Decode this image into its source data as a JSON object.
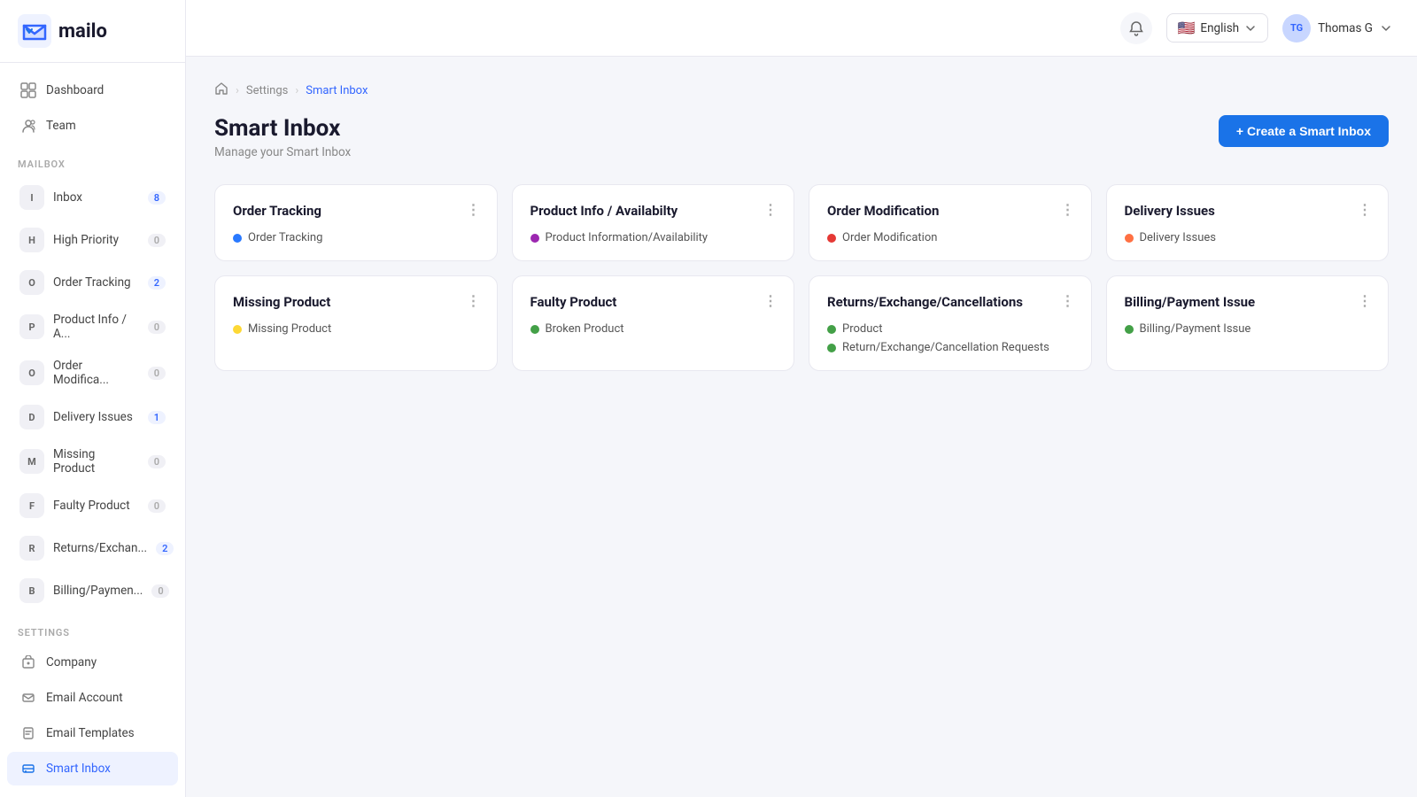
{
  "logo": {
    "text": "mailo"
  },
  "topbar": {
    "language": "English",
    "user_initials": "TG",
    "user_name": "Thomas G"
  },
  "breadcrumb": {
    "home": "home",
    "settings": "Settings",
    "current": "Smart Inbox"
  },
  "page": {
    "title": "Smart Inbox",
    "subtitle": "Manage your Smart Inbox",
    "create_button": "+ Create a Smart Inbox"
  },
  "sidebar": {
    "mailbox_label": "Mailbox",
    "settings_label": "Settings",
    "nav_items": [
      {
        "id": "dashboard",
        "label": "Dashboard",
        "icon": ""
      },
      {
        "id": "team",
        "label": "Team",
        "icon": ""
      }
    ],
    "mailbox_items": [
      {
        "id": "inbox",
        "letter": "I",
        "label": "Inbox",
        "count": "8",
        "nonzero": true
      },
      {
        "id": "high-priority",
        "letter": "H",
        "label": "High Priority",
        "count": "0",
        "nonzero": false
      },
      {
        "id": "order-tracking",
        "letter": "O",
        "label": "Order Tracking",
        "count": "2",
        "nonzero": true
      },
      {
        "id": "product-info",
        "letter": "P",
        "label": "Product Info / A...",
        "count": "0",
        "nonzero": false
      },
      {
        "id": "order-modifica",
        "letter": "O",
        "label": "Order Modifica...",
        "count": "0",
        "nonzero": false
      },
      {
        "id": "delivery-issues",
        "letter": "D",
        "label": "Delivery Issues",
        "count": "1",
        "nonzero": true
      },
      {
        "id": "missing-product",
        "letter": "M",
        "label": "Missing Product",
        "count": "0",
        "nonzero": false
      },
      {
        "id": "faulty-product",
        "letter": "F",
        "label": "Faulty Product",
        "count": "0",
        "nonzero": false
      },
      {
        "id": "returns",
        "letter": "R",
        "label": "Returns/Exchan...",
        "count": "2",
        "nonzero": true
      },
      {
        "id": "billing",
        "letter": "B",
        "label": "Billing/Paymen...",
        "count": "0",
        "nonzero": false
      }
    ],
    "settings_items": [
      {
        "id": "company",
        "label": "Company"
      },
      {
        "id": "email-account",
        "label": "Email Account"
      },
      {
        "id": "email-templates",
        "label": "Email Templates"
      },
      {
        "id": "smart-inbox",
        "label": "Smart Inbox",
        "active": true
      }
    ]
  },
  "cards": [
    {
      "id": "order-tracking",
      "title": "Order Tracking",
      "tags": [
        {
          "label": "Order Tracking",
          "color": "#2979ff"
        }
      ]
    },
    {
      "id": "product-info",
      "title": "Product Info / Availabilty",
      "tags": [
        {
          "label": "Product Information/Availability",
          "color": "#9c27b0"
        }
      ]
    },
    {
      "id": "order-modification",
      "title": "Order Modification",
      "tags": [
        {
          "label": "Order Modification",
          "color": "#e53935"
        }
      ]
    },
    {
      "id": "delivery-issues",
      "title": "Delivery Issues",
      "tags": [
        {
          "label": "Delivery Issues",
          "color": "#ff7043"
        }
      ]
    },
    {
      "id": "missing-product",
      "title": "Missing Product",
      "tags": [
        {
          "label": "Missing Product",
          "color": "#fdd835"
        }
      ]
    },
    {
      "id": "faulty-product",
      "title": "Faulty Product",
      "tags": [
        {
          "label": "Broken Product",
          "color": "#43a047"
        }
      ]
    },
    {
      "id": "returns",
      "title": "Returns/Exchange/Cancellations",
      "tags": [
        {
          "label": "Product",
          "color": "#43a047"
        },
        {
          "label": "Return/Exchange/Cancellation Requests",
          "color": "#43a047"
        }
      ]
    },
    {
      "id": "billing",
      "title": "Billing/Payment Issue",
      "tags": [
        {
          "label": "Billing/Payment Issue",
          "color": "#43a047"
        }
      ]
    }
  ]
}
